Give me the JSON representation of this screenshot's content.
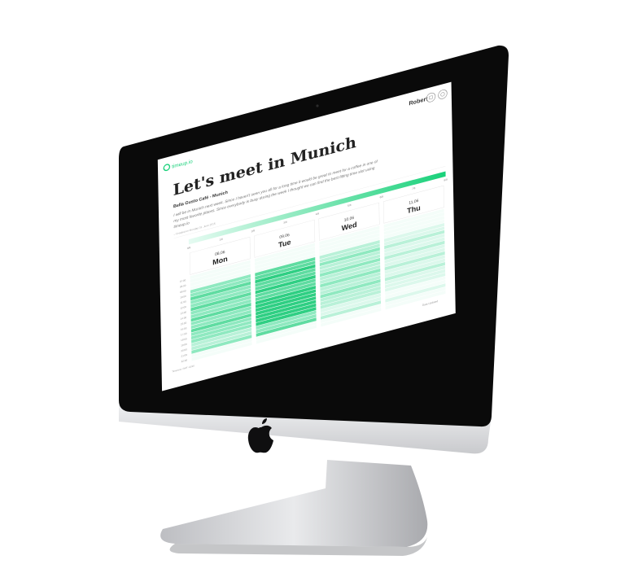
{
  "brand": {
    "name": "timeup.io"
  },
  "user": {
    "name": "Robert"
  },
  "event": {
    "title": "Let's meet in Munich",
    "location": "Bella Gusto Café - Munich",
    "description_line1": "I will be in Munich next week. Since I haven't seen you all for a long time it would be great to meet for a coffee in one of",
    "description_line2": "my most favorite places. Since everybody is busy during the week I thought we can find the best fitting time slot using",
    "description_line3": "timeup.io",
    "created": "– Created on Monday 01. June 2015"
  },
  "overview": {
    "labels": [
      "0/8",
      "1/8",
      "2/8",
      "3/8",
      "4/8",
      "5/8",
      "6/8",
      "7/8",
      "8/8"
    ]
  },
  "days": [
    {
      "date": "08.06",
      "name": "Mon"
    },
    {
      "date": "09.06",
      "name": "Tue"
    },
    {
      "date": "10.06",
      "name": "Wed"
    },
    {
      "date": "11.06",
      "name": "Thu"
    }
  ],
  "time_labels": [
    "07:00",
    "08:00",
    "09:00",
    "10:00",
    "11:00",
    "12:00",
    "13:00",
    "14:00",
    "15:00",
    "16:00",
    "17:00",
    "18:00",
    "19:00",
    "20:00",
    "21:00",
    "22:00"
  ],
  "footer": {
    "timezone": "Timezone: GMT +0200",
    "status": "Data Updated"
  },
  "colors": {
    "accent": "#19d17a",
    "light": "#dff8ee",
    "bezel": "#0a0a0a",
    "aluminium": "#d8d9db"
  }
}
